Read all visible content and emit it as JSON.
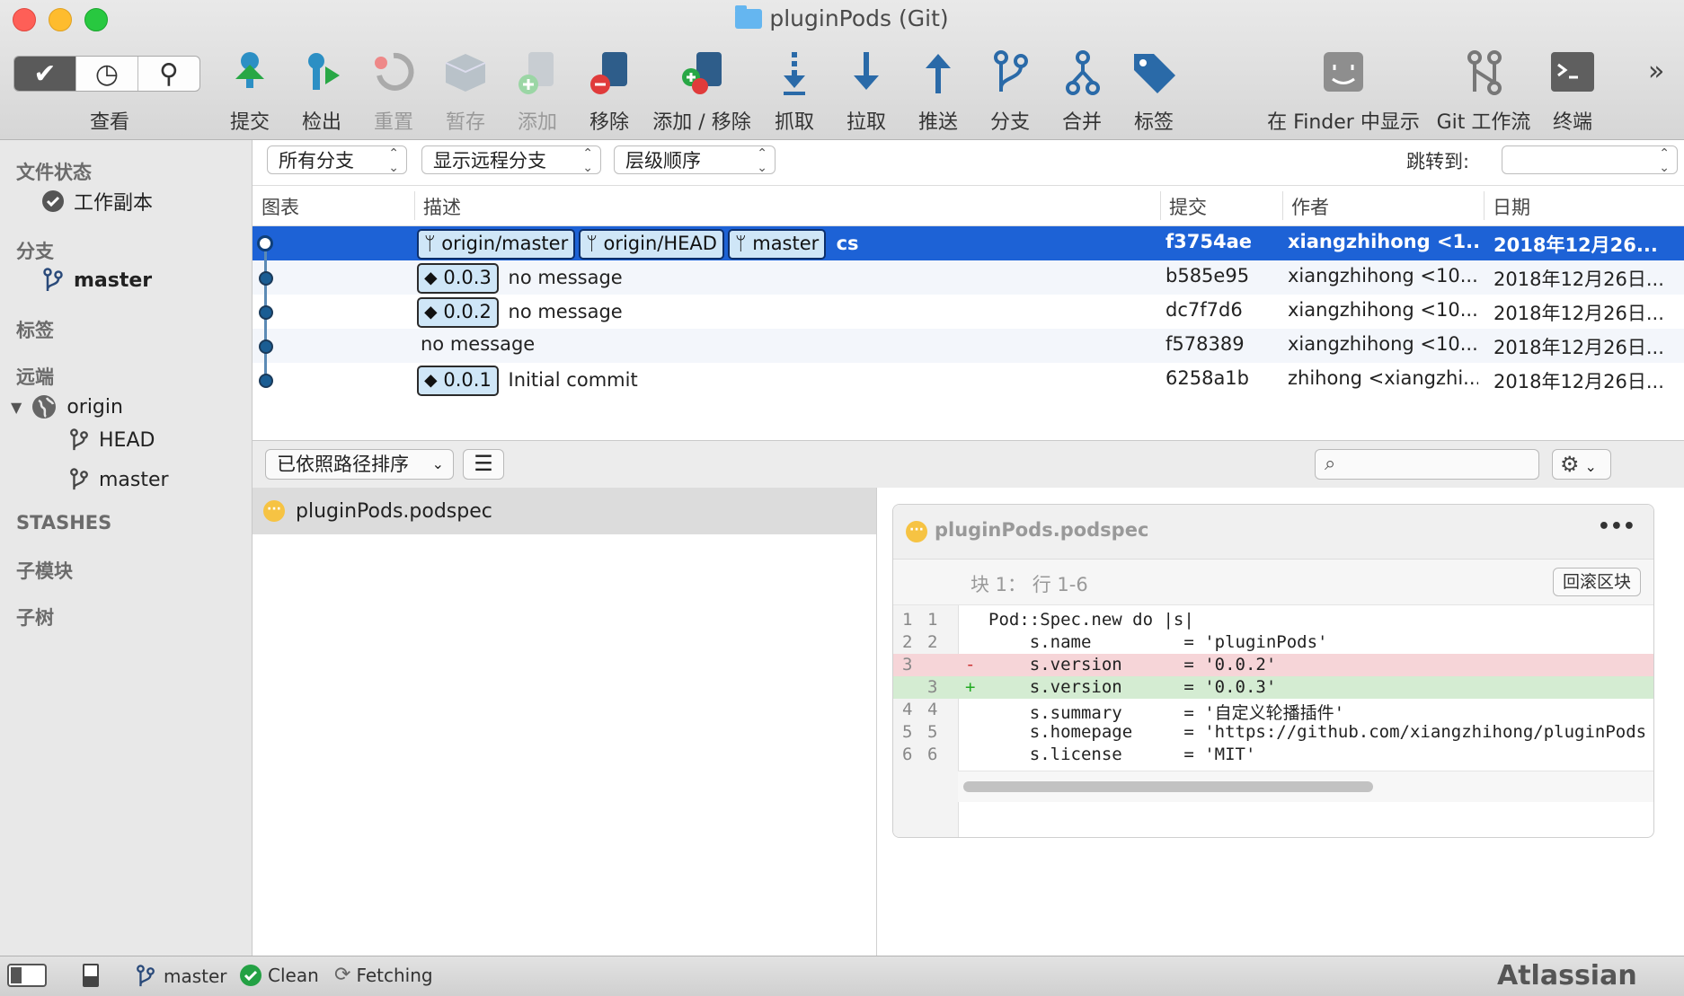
{
  "window": {
    "title": "pluginPods (Git)"
  },
  "toolbar": {
    "view_label": "查看",
    "items": [
      {
        "label": "提交",
        "icon": "commit-icon"
      },
      {
        "label": "检出",
        "icon": "checkout-icon"
      },
      {
        "label": "重置",
        "icon": "reset-icon"
      },
      {
        "label": "暂存",
        "icon": "stash-icon"
      },
      {
        "label": "添加",
        "icon": "add-icon"
      },
      {
        "label": "移除",
        "icon": "remove-icon"
      },
      {
        "label": "添加 / 移除",
        "icon": "add-remove-icon"
      },
      {
        "label": "抓取",
        "icon": "fetch-icon"
      },
      {
        "label": "拉取",
        "icon": "pull-icon"
      },
      {
        "label": "推送",
        "icon": "push-icon"
      },
      {
        "label": "分支",
        "icon": "branch-icon"
      },
      {
        "label": "合并",
        "icon": "merge-icon"
      },
      {
        "label": "标签",
        "icon": "tag-icon"
      },
      {
        "label": "在 Finder 中显示",
        "icon": "finder-icon"
      },
      {
        "label": "Git 工作流",
        "icon": "git-flow-icon"
      },
      {
        "label": "终端",
        "icon": "terminal-icon"
      }
    ],
    "overflow": "»"
  },
  "sidebar": {
    "file_status_header": "文件状态",
    "working_copy": "工作副本",
    "branches_header": "分支",
    "current_branch": "master",
    "tags_header": "标签",
    "remotes_header": "远端",
    "remote_name": "origin",
    "remote_branches": [
      "HEAD",
      "master"
    ],
    "stashes_header": "STASHES",
    "submodules_header": "子模块",
    "subtrees_header": "子树"
  },
  "filters": {
    "branches": "所有分支",
    "remote": "显示远程分支",
    "order": "层级顺序",
    "jump_label": "跳转到:",
    "jump_value": ""
  },
  "commit_table": {
    "headers": {
      "graph": "图表",
      "description": "描述",
      "commit": "提交",
      "author": "作者",
      "date": "日期"
    },
    "rows": [
      {
        "tags": [
          "origin/master",
          "origin/HEAD",
          "master"
        ],
        "message": "cs",
        "commit": "f3754ae",
        "author": "xiangzhihong <1...",
        "date": "2018年12月26..."
      },
      {
        "tags": [
          "0.0.3"
        ],
        "message": "no message",
        "commit": "b585e95",
        "author": "xiangzhihong <10...",
        "date": "2018年12月26日..."
      },
      {
        "tags": [
          "0.0.2"
        ],
        "message": "no message",
        "commit": "dc7f7d6",
        "author": "xiangzhihong <10...",
        "date": "2018年12月26日..."
      },
      {
        "tags": [],
        "message": "no message",
        "commit": "f578389",
        "author": "xiangzhihong <10...",
        "date": "2018年12月26日..."
      },
      {
        "tags": [
          "0.0.1"
        ],
        "message": "Initial commit",
        "commit": "6258a1b",
        "author": "zhihong <xiangzhi...",
        "date": "2018年12月26日..."
      }
    ]
  },
  "midbar": {
    "sort_label": "已依照路径排序",
    "search_placeholder": ""
  },
  "files": [
    {
      "name": "pluginPods.podspec",
      "status": "pending"
    }
  ],
  "diff": {
    "file_name": "pluginPods.podspec",
    "hunk_label": "块 1： 行 1-6",
    "revert_button": "回滚区块",
    "more": "•••",
    "lines": [
      {
        "old": "1",
        "new": "1",
        "type": "ctx",
        "sign": "",
        "text": "Pod::Spec.new do |s|"
      },
      {
        "old": "2",
        "new": "2",
        "type": "ctx",
        "sign": "",
        "text": "    s.name         = 'pluginPods'"
      },
      {
        "old": "3",
        "new": "",
        "type": "del",
        "sign": "-",
        "text": "    s.version      = '0.0.2'"
      },
      {
        "old": "",
        "new": "3",
        "type": "add",
        "sign": "+",
        "text": "    s.version      = '0.0.3'"
      },
      {
        "old": "4",
        "new": "4",
        "type": "ctx",
        "sign": "",
        "text": "    s.summary      = '自定义轮播插件'"
      },
      {
        "old": "5",
        "new": "5",
        "type": "ctx",
        "sign": "",
        "text": "    s.homepage     = 'https://github.com/xiangzhihong/pluginPods"
      },
      {
        "old": "6",
        "new": "6",
        "type": "ctx",
        "sign": "",
        "text": "    s.license      = 'MIT'"
      }
    ]
  },
  "statusbar": {
    "branch": "master",
    "clean": "Clean",
    "fetching": "Fetching",
    "brand": "Atlassian"
  }
}
